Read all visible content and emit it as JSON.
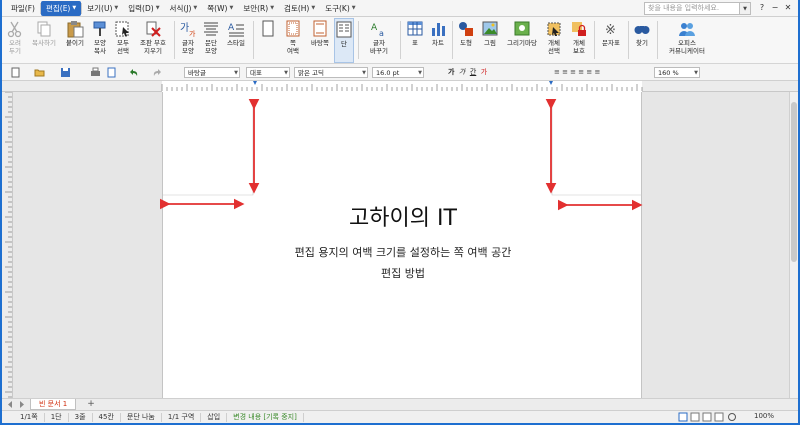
{
  "menu": {
    "items": [
      {
        "label": "파일(F)",
        "active": false
      },
      {
        "label": "편집(E)",
        "active": true
      },
      {
        "label": "보기(U)",
        "active": false
      },
      {
        "label": "입력(D)",
        "active": false
      },
      {
        "label": "서식(J)",
        "active": false
      },
      {
        "label": "쪽(W)",
        "active": false
      },
      {
        "label": "보안(R)",
        "active": false
      },
      {
        "label": "검토(H)",
        "active": false
      },
      {
        "label": "도구(K)",
        "active": false
      }
    ],
    "search_placeholder": "찾을 내용을 입력하세요.",
    "window_controls": [
      "?",
      "−",
      "✕"
    ]
  },
  "ribbon": {
    "buttons": [
      {
        "label": "오려\n두기",
        "icon": "scissors-icon",
        "disabled": true
      },
      {
        "label": "복사하기",
        "icon": "copy-icon",
        "disabled": true
      },
      {
        "label": "붙이기",
        "icon": "clipboard-icon",
        "disabled": false
      },
      {
        "label": "모양\n복사",
        "icon": "format-painter-icon",
        "disabled": false
      },
      {
        "label": "모두\n선택",
        "icon": "select-all-icon",
        "disabled": false
      },
      {
        "label": "조판 부호\n지우기",
        "icon": "clear-marks-icon",
        "disabled": false
      },
      {
        "label": "글자\n모양",
        "icon": "char-shape-icon",
        "disabled": false
      },
      {
        "label": "문단\n모양",
        "icon": "para-shape-icon",
        "disabled": false
      },
      {
        "label": "스타일",
        "icon": "style-icon",
        "disabled": false
      },
      {
        "label": "",
        "icon": "page-icon",
        "disabled": false
      },
      {
        "label": "쪽\n여백",
        "icon": "page-margin-icon",
        "disabled": false
      },
      {
        "label": "바탕쪽",
        "icon": "master-page-icon",
        "disabled": false
      },
      {
        "label": "단",
        "icon": "columns-icon",
        "disabled": false
      },
      {
        "label": "글자\n바꾸기",
        "icon": "replace-char-icon",
        "disabled": false
      },
      {
        "label": "표",
        "icon": "table-icon",
        "disabled": false
      },
      {
        "label": "차트",
        "icon": "chart-icon",
        "disabled": false
      },
      {
        "label": "도형",
        "icon": "shape-icon",
        "disabled": false
      },
      {
        "label": "그림",
        "icon": "picture-icon",
        "disabled": false
      },
      {
        "label": "그리기마당",
        "icon": "clipart-icon",
        "disabled": false
      },
      {
        "label": "개체\n선택",
        "icon": "object-select-icon",
        "disabled": false
      },
      {
        "label": "개체\n보호",
        "icon": "object-lock-icon",
        "disabled": false
      },
      {
        "label": "문자표",
        "icon": "symbol-icon",
        "disabled": false
      },
      {
        "label": "찾기",
        "icon": "find-icon",
        "disabled": false
      },
      {
        "label": "오피스\n커뮤니케이터",
        "icon": "communicator-icon",
        "disabled": false
      }
    ]
  },
  "format_bar": {
    "style_value": "바탕글",
    "lang_value": "대표",
    "font_value": "맑은 고딕",
    "size_value": "16.0",
    "size_unit": "pt",
    "zoom_value": "160",
    "zoom_unit": "%"
  },
  "document": {
    "title": "고하이의 IT",
    "body_line1": "편집 용지의 여백 크기를 설정하는 쪽 여백 공간",
    "body_line2": "편집 방법"
  },
  "tabs": {
    "active_label": "빈 문서 1",
    "add_label": "+"
  },
  "status": {
    "items": [
      {
        "text": "1/1쪽",
        "green": false
      },
      {
        "text": "1단",
        "green": false
      },
      {
        "text": "3줄",
        "green": false
      },
      {
        "text": "45칸",
        "green": false
      },
      {
        "text": "문단 나눔",
        "green": false
      },
      {
        "text": "1/1 구역",
        "green": false
      },
      {
        "text": "삽입",
        "green": false
      },
      {
        "text": "변경 내용 [기록 중지]",
        "green": true
      }
    ],
    "zoom": "100%"
  },
  "colors": {
    "accent": "#2a6bc4",
    "arrow": "#e23030",
    "frame": "#1e6fd0"
  }
}
